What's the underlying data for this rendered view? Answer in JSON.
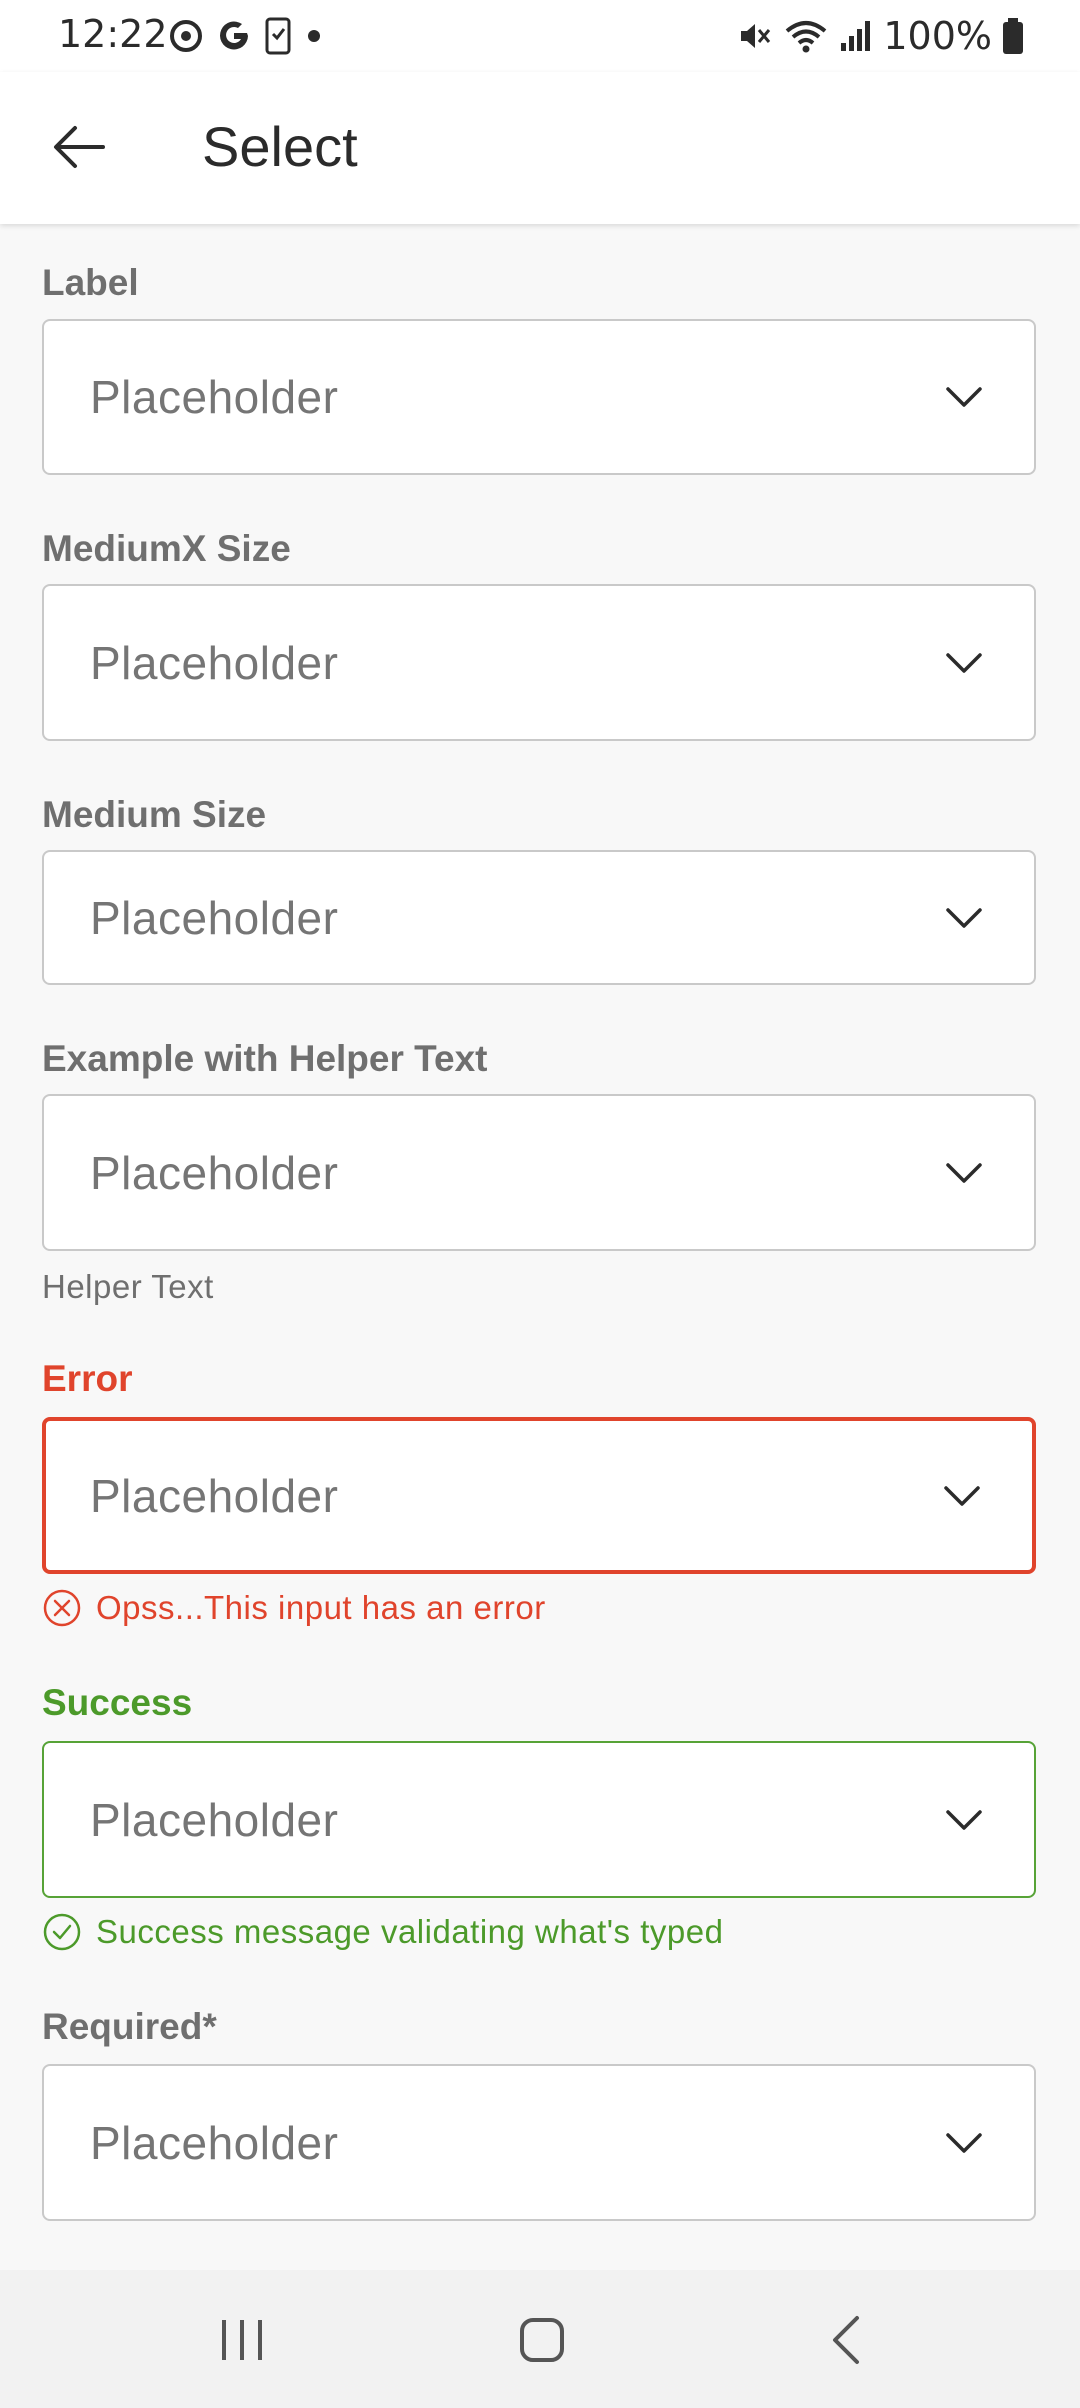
{
  "status_bar": {
    "time": "12:22",
    "battery": "100%"
  },
  "app_bar": {
    "title": "Select"
  },
  "fields": [
    {
      "label": "Label",
      "placeholder": "Placeholder"
    },
    {
      "label": "MediumX Size",
      "placeholder": "Placeholder"
    },
    {
      "label": "Medium Size",
      "placeholder": "Placeholder"
    },
    {
      "label": "Example with Helper Text",
      "placeholder": "Placeholder",
      "helper": "Helper Text"
    },
    {
      "label": "Error",
      "placeholder": "Placeholder",
      "message": "Opss...This input has an error"
    },
    {
      "label": "Success",
      "placeholder": "Placeholder",
      "message": "Success message validating what's typed"
    },
    {
      "label": "Required*",
      "placeholder": "Placeholder"
    }
  ],
  "colors": {
    "error": "#e0442c",
    "success": "#4c9a2a",
    "border": "#c9c9c9"
  },
  "icons": {
    "back": "arrow-left-icon",
    "chevron": "chevron-down-icon",
    "error": "error-circle-x-icon",
    "success": "check-circle-icon",
    "nav_recents": "recents-icon",
    "nav_home": "home-icon",
    "nav_back": "nav-back-icon"
  }
}
